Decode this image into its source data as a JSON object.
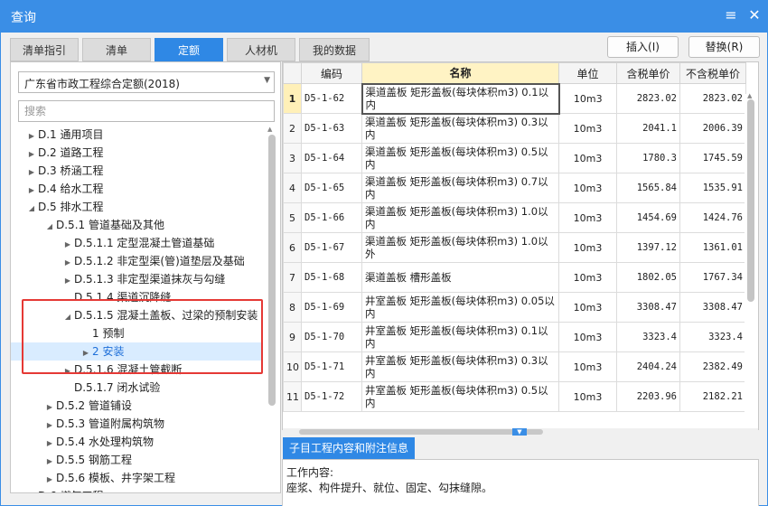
{
  "window": {
    "title": "查询",
    "menu_icon": "≡",
    "close_icon": "✕"
  },
  "tabs": [
    {
      "label": "清单指引"
    },
    {
      "label": "清单"
    },
    {
      "label": "定额"
    },
    {
      "label": "人材机"
    },
    {
      "label": "我的数据"
    }
  ],
  "actions": {
    "insert_label": "插入(I)",
    "replace_label": "替换(R)"
  },
  "left": {
    "dropdown_value": "广东省市政工程综合定额(2018)",
    "search_placeholder": "搜索",
    "tree": [
      {
        "text": "D.1 通用项目",
        "level": 0,
        "state": "collapsed"
      },
      {
        "text": "D.2 道路工程",
        "level": 0,
        "state": "collapsed"
      },
      {
        "text": "D.3 桥涵工程",
        "level": 0,
        "state": "collapsed"
      },
      {
        "text": "D.4 给水工程",
        "level": 0,
        "state": "collapsed"
      },
      {
        "text": "D.5 排水工程",
        "level": 0,
        "state": "expanded"
      },
      {
        "text": "D.5.1 管道基础及其他",
        "level": 1,
        "state": "expanded"
      },
      {
        "text": "D.5.1.1 定型混凝土管道基础",
        "level": 2,
        "state": "collapsed"
      },
      {
        "text": "D.5.1.2 非定型渠(管)道垫层及基础",
        "level": 2,
        "state": "collapsed"
      },
      {
        "text": "D.5.1.3 非定型渠道抹灰与勾缝",
        "level": 2,
        "state": "collapsed"
      },
      {
        "text": "D.5.1.4 渠道沉降缝",
        "level": 2,
        "state": "leaf"
      },
      {
        "text": "D.5.1.5 混凝土盖板、过梁的预制安装",
        "level": 2,
        "state": "expanded"
      },
      {
        "text": "1 预制",
        "level": 3,
        "state": "leaf"
      },
      {
        "text": "2 安装",
        "level": 3,
        "state": "collapsed",
        "selected": true
      },
      {
        "text": "D.5.1.6 混凝土管截断",
        "level": 2,
        "state": "collapsed"
      },
      {
        "text": "D.5.1.7 闭水试验",
        "level": 2,
        "state": "leaf"
      },
      {
        "text": "D.5.2 管道铺设",
        "level": 1,
        "state": "collapsed"
      },
      {
        "text": "D.5.3 管道附属构筑物",
        "level": 1,
        "state": "collapsed"
      },
      {
        "text": "D.5.4 水处理构筑物",
        "level": 1,
        "state": "collapsed"
      },
      {
        "text": "D.5.5 钢筋工程",
        "level": 1,
        "state": "collapsed"
      },
      {
        "text": "D.5.6 模板、井字架工程",
        "level": 1,
        "state": "collapsed"
      },
      {
        "text": "D.6 燃气工程",
        "level": 0,
        "state": "collapsed"
      }
    ]
  },
  "grid": {
    "headers": {
      "code": "编码",
      "name": "名称",
      "unit": "单位",
      "tax_price": "含税单价",
      "notax_price": "不含税单价"
    },
    "rows": [
      {
        "num": "1",
        "code": "D5-1-62",
        "name": "渠道盖板 矩形盖板(每块体积m3) 0.1以内",
        "unit": "10m3",
        "tax": "2823.02",
        "notax": "2823.02",
        "selected": true
      },
      {
        "num": "2",
        "code": "D5-1-63",
        "name": "渠道盖板 矩形盖板(每块体积m3) 0.3以内",
        "unit": "10m3",
        "tax": "2041.1",
        "notax": "2006.39"
      },
      {
        "num": "3",
        "code": "D5-1-64",
        "name": "渠道盖板 矩形盖板(每块体积m3) 0.5以内",
        "unit": "10m3",
        "tax": "1780.3",
        "notax": "1745.59"
      },
      {
        "num": "4",
        "code": "D5-1-65",
        "name": "渠道盖板 矩形盖板(每块体积m3) 0.7以内",
        "unit": "10m3",
        "tax": "1565.84",
        "notax": "1535.91"
      },
      {
        "num": "5",
        "code": "D5-1-66",
        "name": "渠道盖板 矩形盖板(每块体积m3) 1.0以内",
        "unit": "10m3",
        "tax": "1454.69",
        "notax": "1424.76"
      },
      {
        "num": "6",
        "code": "D5-1-67",
        "name": "渠道盖板 矩形盖板(每块体积m3) 1.0以外",
        "unit": "10m3",
        "tax": "1397.12",
        "notax": "1361.01"
      },
      {
        "num": "7",
        "code": "D5-1-68",
        "name": "渠道盖板 槽形盖板",
        "unit": "10m3",
        "tax": "1802.05",
        "notax": "1767.34"
      },
      {
        "num": "8",
        "code": "D5-1-69",
        "name": "井室盖板 矩形盖板(每块体积m3) 0.05以内",
        "unit": "10m3",
        "tax": "3308.47",
        "notax": "3308.47"
      },
      {
        "num": "9",
        "code": "D5-1-70",
        "name": "井室盖板 矩形盖板(每块体积m3) 0.1以内",
        "unit": "10m3",
        "tax": "3323.4",
        "notax": "3323.4"
      },
      {
        "num": "10",
        "code": "D5-1-71",
        "name": "井室盖板 矩形盖板(每块体积m3) 0.3以内",
        "unit": "10m3",
        "tax": "2404.24",
        "notax": "2382.49"
      },
      {
        "num": "11",
        "code": "D5-1-72",
        "name": "井室盖板 矩形盖板(每块体积m3) 0.5以内",
        "unit": "10m3",
        "tax": "2203.96",
        "notax": "2182.21"
      }
    ]
  },
  "info": {
    "tab_label": "子目工程内容和附注信息",
    "heading": "工作内容:",
    "content": "座浆、构件提升、就位、固定、勾抹缝隙。"
  },
  "colors": {
    "accent": "#2f88e5",
    "highlight_box": "#e53935",
    "name_header_bg": "#fff3c4"
  }
}
